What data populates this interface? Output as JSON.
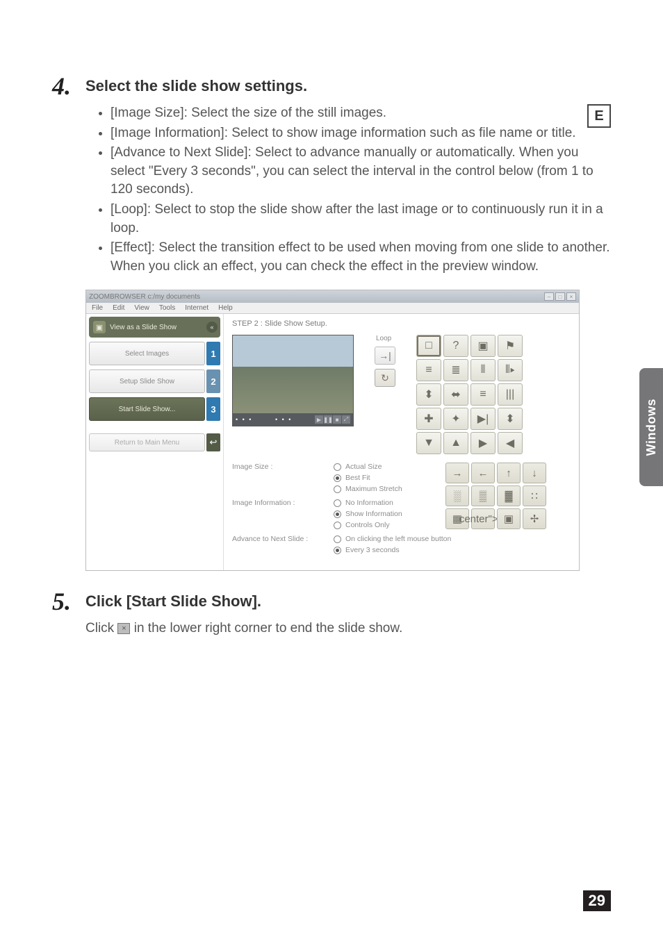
{
  "page_number": "29",
  "lang_badge": "E",
  "side_tab_label": "Windows",
  "step4": {
    "number": "4.",
    "heading": "Select the slide show settings.",
    "bullets": [
      "[Image Size]: Select the size of the still images.",
      "[Image Information]: Select to show image information such as file name or title.",
      "[Advance to Next Slide]: Select to advance manually or automatically. When you select \"Every 3 seconds\", you can select the interval in the control below (from 1 to 120 seconds).",
      "[Loop]: Select to stop the slide show after the last image or to continuously run it in a loop.",
      "[Effect]: Select the transition effect to be used when moving from one slide to another. When you click an effect, you can check the effect in the preview window."
    ]
  },
  "step5": {
    "number": "5.",
    "heading": "Click [Start Slide Show].",
    "body_prefix": "Click ",
    "body_suffix": " in the lower right corner to end the slide show."
  },
  "screenshot": {
    "title": "ZOOMBROWSER c:/my documents",
    "menubar": [
      "File",
      "Edit",
      "View",
      "Tools",
      "Internet",
      "Help"
    ],
    "mode_label": "View as a Slide Show",
    "sidebar": {
      "steps": [
        {
          "label": "Select Images",
          "num": "1"
        },
        {
          "label": "Setup Slide Show",
          "num": "2"
        },
        {
          "label": "Start Slide Show...",
          "num": "3"
        }
      ],
      "return_label": "Return to Main Menu"
    },
    "main": {
      "step_title": "STEP 2 : Slide Show Setup.",
      "loop_label": "Loop",
      "image_size": {
        "label": "Image Size :",
        "options": [
          "Actual Size",
          "Best Fit",
          "Maximum Stretch"
        ],
        "selected": 1
      },
      "image_info": {
        "label": "Image Information :",
        "options": [
          "No Information",
          "Show Information",
          "Controls Only"
        ],
        "selected": 1
      },
      "advance": {
        "label": "Advance to Next Slide :",
        "options": [
          "On clicking the left mouse button",
          "Every 3 seconds"
        ],
        "selected": 1
      }
    }
  }
}
